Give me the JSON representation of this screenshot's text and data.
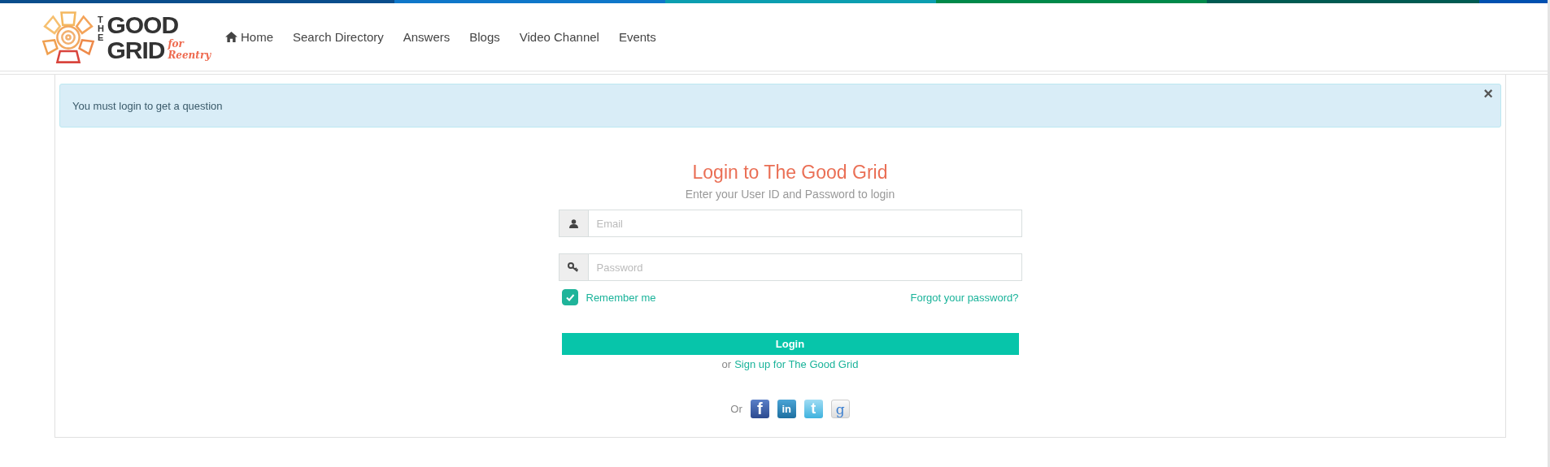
{
  "logo": {
    "the": "THE",
    "good": "GOOD",
    "grid": "GRID",
    "tagline": "for Reentry"
  },
  "nav": [
    {
      "label": "Home",
      "kind": "home"
    },
    {
      "label": "Search Directory",
      "kind": "link"
    },
    {
      "label": "Answers",
      "kind": "link"
    },
    {
      "label": "Blogs",
      "kind": "link"
    },
    {
      "label": "Video Channel",
      "kind": "link"
    },
    {
      "label": "Events",
      "kind": "link"
    }
  ],
  "alert": {
    "message": "You must login to get a question",
    "close": "×"
  },
  "login": {
    "title": "Login to The Good Grid",
    "subtitle": "Enter your User ID and Password to login",
    "fields": [
      {
        "kind": "user",
        "placeholder": "Email"
      },
      {
        "kind": "key",
        "placeholder": "Password"
      }
    ],
    "remember": {
      "label": "Remember me",
      "checked": true
    },
    "forgot": "Forgot your password?",
    "button": "Login",
    "signup_prefix": "or",
    "signup_link": "Sign up for The Good Grid",
    "social_prefix": "Or",
    "social": [
      {
        "kind": "facebook",
        "glyph": "f"
      },
      {
        "kind": "linkedin",
        "glyph": "in"
      },
      {
        "kind": "twitter",
        "glyph": "t"
      },
      {
        "kind": "google",
        "glyph": "g"
      }
    ]
  }
}
